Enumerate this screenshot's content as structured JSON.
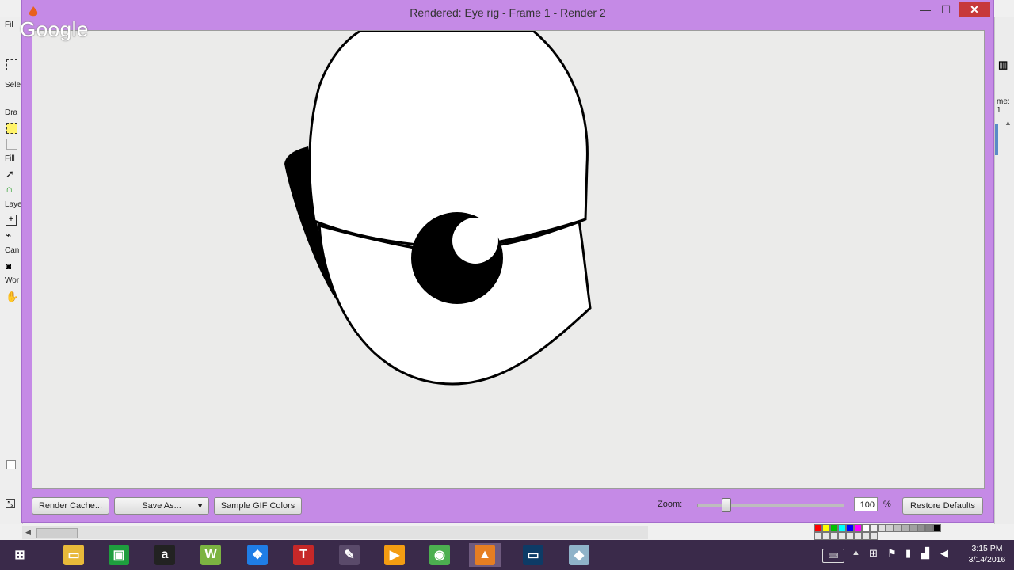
{
  "window": {
    "title": "Rendered: Eye rig - Frame 1 - Render 2",
    "minimize_glyph": "—",
    "maximize_glyph": "☐",
    "close_glyph": "✕"
  },
  "overlay": {
    "watermark": "Google"
  },
  "toolbar": {
    "render_cache_label": "Render Cache...",
    "save_as_label": "Save As...",
    "save_as_caret": "▼",
    "sample_gif_label": "Sample GIF Colors",
    "zoom_label": "Zoom:",
    "zoom_value": "100",
    "zoom_unit": "%",
    "zoom_level": 0.2,
    "restore_defaults_label": "Restore Defaults"
  },
  "background_app": {
    "left_labels": [
      "Fil",
      "Sele",
      "Dra",
      "Fill",
      "Laye",
      "Can",
      "Wor"
    ],
    "right_label": "me: 1"
  },
  "palette_colors": [
    "#ff0000",
    "#ffff00",
    "#00c000",
    "#00ffff",
    "#0000ff",
    "#ff00ff",
    "#ffffff",
    "#f0f0f0",
    "#e0e0e0",
    "#d0d0d0",
    "#c0c0c0",
    "#b0b0b0",
    "#a0a0a0",
    "#909090",
    "#808080",
    "#000000"
  ],
  "taskbar": {
    "apps": [
      {
        "name": "start-button",
        "glyph": "⊞",
        "color": "#3a2a4a"
      },
      {
        "name": "file-explorer-icon",
        "glyph": "▭",
        "color": "#e8b93a"
      },
      {
        "name": "store-icon",
        "glyph": "▣",
        "color": "#1e9e3e"
      },
      {
        "name": "amazon-icon",
        "glyph": "a",
        "color": "#222222"
      },
      {
        "name": "w-app-icon",
        "glyph": "W",
        "color": "#7cb342"
      },
      {
        "name": "dropbox-icon",
        "glyph": "❖",
        "color": "#1f7de6"
      },
      {
        "name": "t-app-icon",
        "glyph": "T",
        "color": "#c62828"
      },
      {
        "name": "pen-app-icon",
        "glyph": "✎",
        "color": "#5a4a6a"
      },
      {
        "name": "media-player-icon",
        "glyph": "▶",
        "color": "#f39c12"
      },
      {
        "name": "chrome-icon",
        "glyph": "◉",
        "color": "#4caf50"
      },
      {
        "name": "anime-studio-icon",
        "glyph": "▲",
        "color": "#e67e22"
      },
      {
        "name": "screen-app-icon",
        "glyph": "▭",
        "color": "#0d3b66"
      },
      {
        "name": "eraser-app-icon",
        "glyph": "◆",
        "color": "#8fb3c9"
      }
    ],
    "time": "3:15 PM",
    "date": "3/14/2016"
  }
}
